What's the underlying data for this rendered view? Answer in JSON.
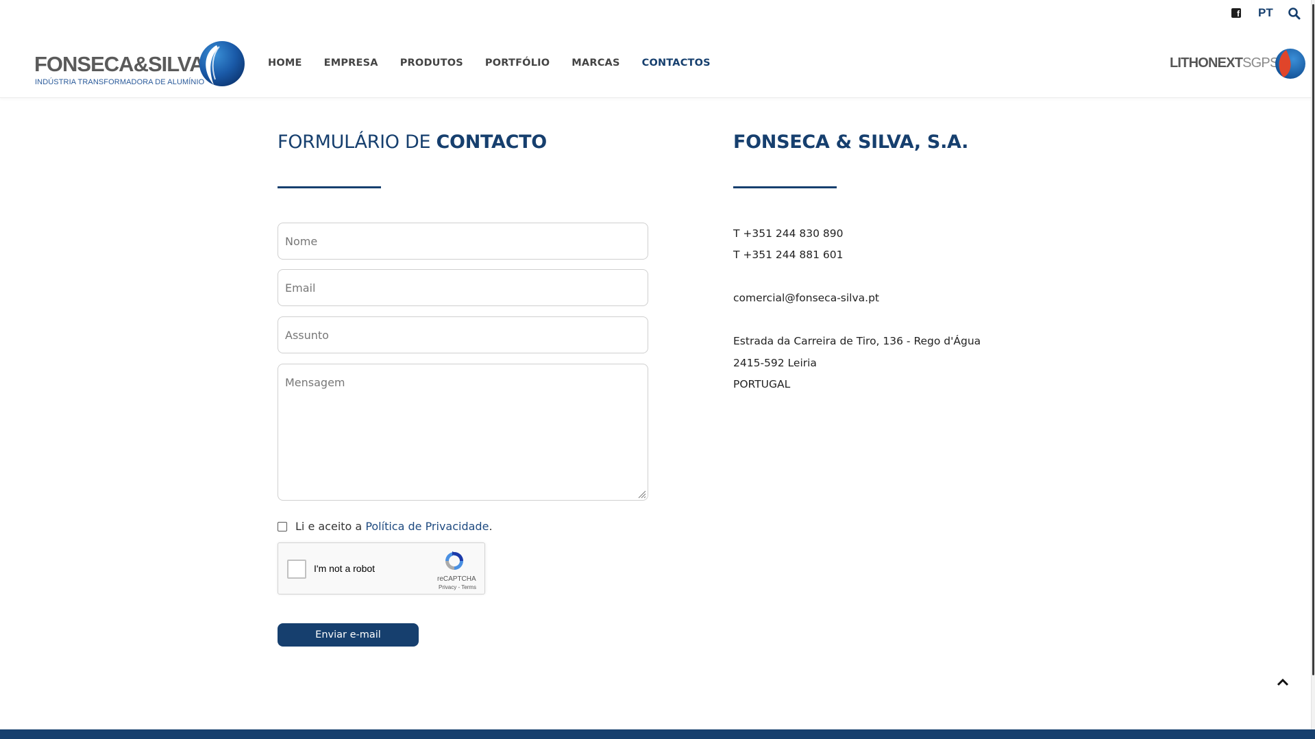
{
  "topbar": {
    "facebook_icon": "facebook-icon",
    "language": "PT",
    "search_icon": "search-icon"
  },
  "header": {
    "logo": {
      "brand": "FONSECA&SILVA",
      "tagline": "INDÚSTRIA TRANSFORMADORA DE ALUMÍNIO"
    },
    "nav": [
      {
        "label": "HOME",
        "active": false
      },
      {
        "label": "EMPRESA",
        "active": false
      },
      {
        "label": "PRODUTOS",
        "active": false
      },
      {
        "label": "PORTFÓLIO",
        "active": false
      },
      {
        "label": "MARCAS",
        "active": false
      },
      {
        "label": "CONTACTOS",
        "active": true
      }
    ],
    "partner": {
      "bold": "LITHONEXT",
      "light": "SGPS"
    }
  },
  "form": {
    "title_light": "FORMULÁRIO DE ",
    "title_bold": "CONTACTO",
    "name_placeholder": "Nome",
    "email_placeholder": "Email",
    "subject_placeholder": "Assunto",
    "message_placeholder": "Mensagem",
    "consent_prefix": "Li e aceito a ",
    "consent_link": "Política de Privacidade",
    "consent_suffix": ".",
    "recaptcha_label": "I'm not a robot",
    "recaptcha_brand": "reCAPTCHA",
    "recaptcha_links": "Privacy - Terms",
    "submit_label": "Enviar e-mail"
  },
  "company": {
    "title": "FONSECA & SILVA, S.A.",
    "phone_1": "T +351 244 830 890",
    "phone_2": "T +351 244 881 601",
    "email": "comercial@fonseca-silva.pt",
    "address_1": "Estrada da Carreira de Tiro, 136 - Rego d'Água",
    "address_2": "2415-592 Leiria",
    "country": "PORTUGAL"
  },
  "colors": {
    "brand_blue": "#163f6e",
    "link_blue": "#1e4a80",
    "partner_red": "#e0452a"
  }
}
